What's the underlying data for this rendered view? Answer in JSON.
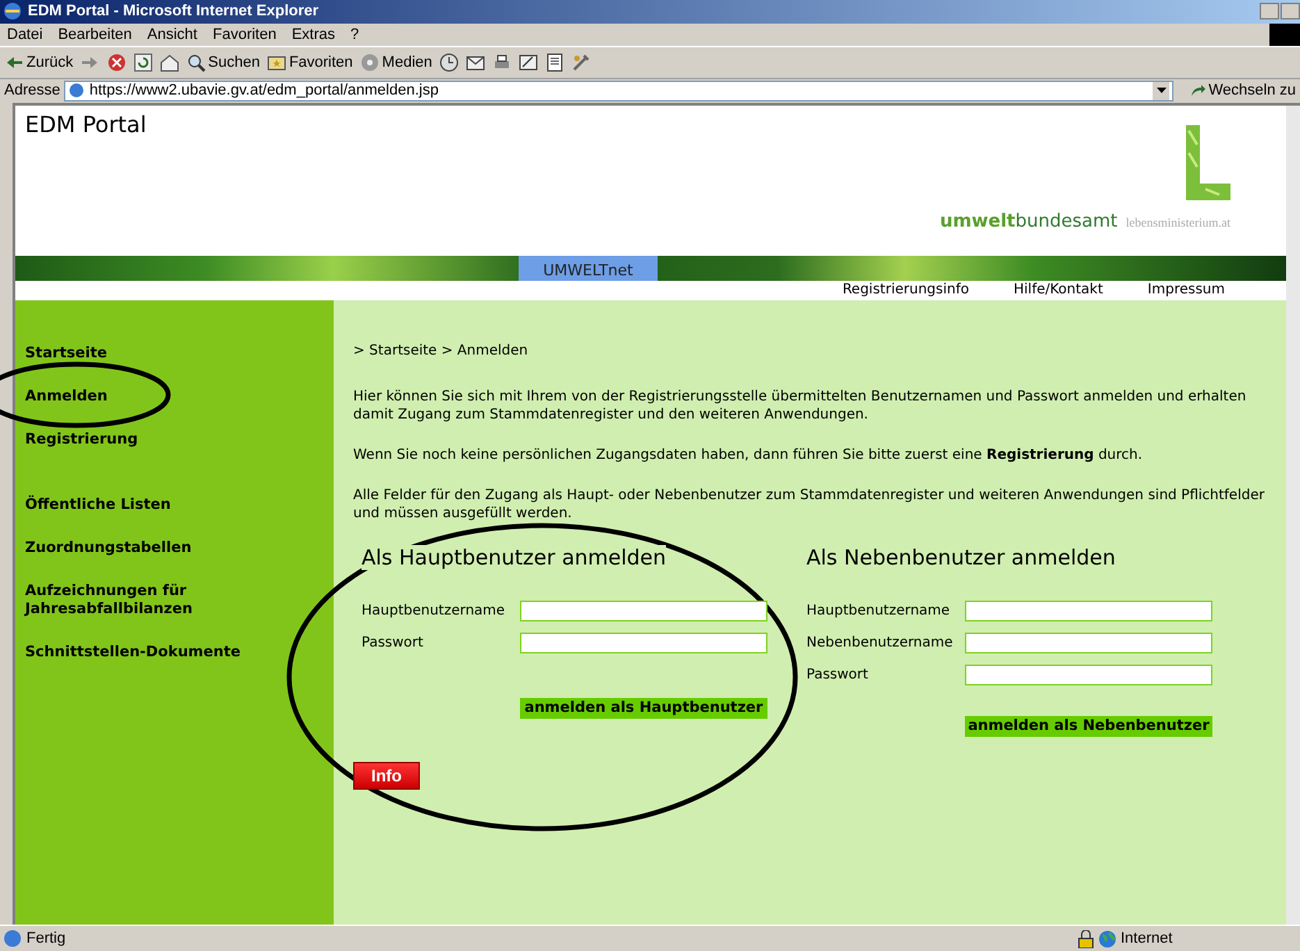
{
  "window": {
    "title": "EDM Portal - Microsoft Internet Explorer"
  },
  "menu": [
    "Datei",
    "Bearbeiten",
    "Ansicht",
    "Favoriten",
    "Extras",
    "?"
  ],
  "toolbar": [
    {
      "kind": "back",
      "label": "Zurück"
    },
    {
      "kind": "forward"
    },
    {
      "kind": "stop"
    },
    {
      "kind": "refresh"
    },
    {
      "kind": "home"
    },
    {
      "kind": "search",
      "label": "Suchen"
    },
    {
      "kind": "favorites",
      "label": "Favoriten"
    },
    {
      "kind": "media",
      "label": "Medien"
    },
    {
      "kind": "history"
    },
    {
      "kind": "mail"
    },
    {
      "kind": "print"
    },
    {
      "kind": "edit"
    },
    {
      "kind": "document"
    },
    {
      "kind": "tools"
    }
  ],
  "address_bar": {
    "label": "Adresse",
    "url": "https://www2.ubavie.gv.at/edm_portal/anmelden.jsp",
    "go": "Wechseln zu"
  },
  "page": {
    "site_title": "EDM Portal",
    "logo": {
      "name": "**umwelt**bundesamt",
      "partner": "lebensministerium.at"
    },
    "banner_tab": "UMWELTnet",
    "top_links": [
      "Registrierungsinfo",
      "Hilfe/Kontakt",
      "Impressum"
    ],
    "sidebar": [
      {
        "items": [
          "Startseite",
          "Anmelden",
          "Registrierung"
        ]
      },
      {
        "items": [
          "Öffentliche Listen",
          "Zuordnungstabellen",
          "Aufzeichnungen für Jahresabfallbilanzen",
          "Schnittstellen-Dokumente"
        ]
      }
    ],
    "breadcrumb": "> Startseite > Anmelden",
    "paragraphs": [
      "Hier können Sie sich mit Ihrem von der Registrierungsstelle übermittelten Benutzernamen und Passwort anmelden und erhalten damit Zugang zum Stammdatenregister und den weiteren Anwendungen.",
      "Wenn Sie noch keine persönlichen Zugangsdaten haben, dann führen Sie bitte zuerst eine **Registrierung** durch.",
      "Alle Felder für den Zugang als Haupt- oder Nebenbenutzer zum Stammdatenregister und weiteren Anwendungen sind Pflichtfelder und müssen ausgefüllt werden."
    ],
    "forms": [
      {
        "title": "Als Hauptbenutzer anmelden",
        "fields": [
          {
            "label": "Hauptbenutzername"
          },
          {
            "label": "Passwort"
          }
        ],
        "button": "anmelden als Hauptbenutzer"
      },
      {
        "title": "Als Nebenbenutzer anmelden",
        "fields": [
          {
            "label": "Hauptbenutzername"
          },
          {
            "label": "Nebenbenutzername"
          },
          {
            "label": "Passwort"
          }
        ],
        "button": "anmelden als Nebenbenutzer"
      }
    ],
    "info_button": "Info"
  },
  "annotations": [
    {
      "kind": "ellipse"
    },
    {
      "kind": "ellipse"
    }
  ],
  "status_bar": {
    "text": "Fertig",
    "zone": "Internet"
  }
}
